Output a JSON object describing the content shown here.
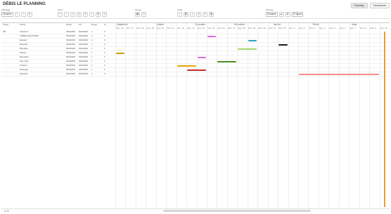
{
  "app": {
    "title": "DÉBIS LE PLANNING"
  },
  "tabs": [
    {
      "label": "Planning"
    },
    {
      "label": "Timesheets"
    }
  ],
  "toolbar": {
    "groups": [
      {
        "label": "Affichage",
        "select": "Semaine",
        "icons": [
          "arrow-left-icon",
          "arrow-right-icon",
          "refresh-icon"
        ]
      },
      {
        "label": "Zoom",
        "select": "",
        "icons": [
          "zoom-in-icon",
          "zoom-out-icon",
          "fit-icon",
          "center-icon",
          "refresh-icon",
          "filter-icon",
          "settings-icon",
          "list-icon"
        ]
      },
      {
        "label": "Temps",
        "select": "",
        "icons": [
          "calendar-icon",
          "clock-icon"
        ]
      },
      {
        "label": "Outils",
        "select": "",
        "icons": [
          "search-icon",
          "link-icon",
          "download-icon",
          "print-icon",
          "export-icon",
          "grid-icon"
        ]
      },
      {
        "label": "Période",
        "select": "Semaine",
        "icons": [
          "lock-icon",
          "settings-icon"
        ]
      }
    ],
    "page_size_select": "10 lignes"
  },
  "left_headers": [
    "Projet",
    "Tâche",
    "Début",
    "Fin",
    "Durée",
    "%"
  ],
  "months": [
    {
      "label": "Septembre"
    },
    {
      "label": "Octobre"
    },
    {
      "label": "Novembre"
    },
    {
      "label": "Décembre"
    },
    {
      "label": "Janvier"
    },
    {
      "label": "Février"
    },
    {
      "label": "Mars"
    }
  ],
  "weeks": [
    "Sem. 36",
    "Sem. 37",
    "Sem. 38",
    "Sem. 39",
    "Sem. 40",
    "Sem. 41",
    "Sem. 42",
    "Sem. 43",
    "Sem. 44",
    "Sem. 45",
    "Sem. 46",
    "Sem. 47",
    "Sem. 48",
    "Sem. 49",
    "Sem. 50",
    "Sem. 51",
    "Sem. 52",
    "Sem. 1",
    "Sem. 2",
    "Sem. 3",
    "Sem. 4",
    "Sem. 5",
    "Sem. 6",
    "Sem. 7",
    "Sem. 8",
    "Sem. 9",
    "Sem. 10"
  ],
  "rows": [
    {
      "project": "P01",
      "task": "Chantier A",
      "start": "09/12/2022",
      "end": "09/12/2022",
      "dur": "1",
      "pct": "0"
    },
    {
      "project": "",
      "task": "CARRELAGE ET BOIS",
      "start": "09/12/2022",
      "end": "09/12/2022",
      "dur": "1",
      "pct": "0"
    },
    {
      "project": "",
      "task": "Extérieur",
      "start": "09/12/2022",
      "end": "09/12/2022",
      "dur": "1",
      "pct": "0"
    },
    {
      "project": "",
      "task": "Électricité",
      "start": "09/12/2022",
      "end": "09/12/2022",
      "dur": "1",
      "pct": "0"
    },
    {
      "project": "",
      "task": "Plomberie",
      "start": "09/12/2022",
      "end": "09/12/2022",
      "dur": "1",
      "pct": "0"
    },
    {
      "project": "",
      "task": "Peinture",
      "start": "09/12/2022",
      "end": "09/12/2022",
      "dur": "1",
      "pct": "0"
    },
    {
      "project": "",
      "task": "Menuiserie",
      "start": "09/12/2022",
      "end": "09/12/2022",
      "dur": "1",
      "pct": "0"
    },
    {
      "project": "",
      "task": "Sols / Murs",
      "start": "09/12/2022",
      "end": "09/12/2022",
      "dur": "1",
      "pct": "0"
    },
    {
      "project": "",
      "task": "Livraison",
      "start": "09/12/2022",
      "end": "09/12/2022",
      "dur": "1",
      "pct": "0"
    },
    {
      "project": "",
      "task": "Nettoyage",
      "start": "09/12/2022",
      "end": "09/12/2022",
      "dur": "1",
      "pct": "0"
    },
    {
      "project": "",
      "task": "Réception",
      "start": "09/12/2022",
      "end": "09/12/2022",
      "dur": "1",
      "pct": "0"
    }
  ],
  "bars": [
    {
      "row": 1,
      "startWeek": 9,
      "len": 1,
      "color": "#e066e0"
    },
    {
      "row": 2,
      "startWeek": 13,
      "len": 1,
      "color": "#2aa7c4"
    },
    {
      "row": 3,
      "startWeek": 16,
      "len": 1,
      "color": "#1a1a1a"
    },
    {
      "row": 4,
      "startWeek": 12,
      "len": 2,
      "color": "#a3d36a"
    },
    {
      "row": 5,
      "startWeek": 0,
      "len": 1,
      "color": "#c9a100"
    },
    {
      "row": 6,
      "startWeek": 8,
      "len": 1,
      "color": "#e066e0"
    },
    {
      "row": 7,
      "startWeek": 10,
      "len": 2,
      "color": "#4a8c1f"
    },
    {
      "row": 8,
      "startWeek": 6,
      "len": 2,
      "color": "#e3a800"
    },
    {
      "row": 9,
      "startWeek": 7,
      "len": 2,
      "color": "#c22b2b"
    },
    {
      "row": 10,
      "startWeek": 18,
      "len": 8,
      "color": "#ff8c8c"
    }
  ],
  "footer": {
    "page_label": "1 / 3"
  }
}
